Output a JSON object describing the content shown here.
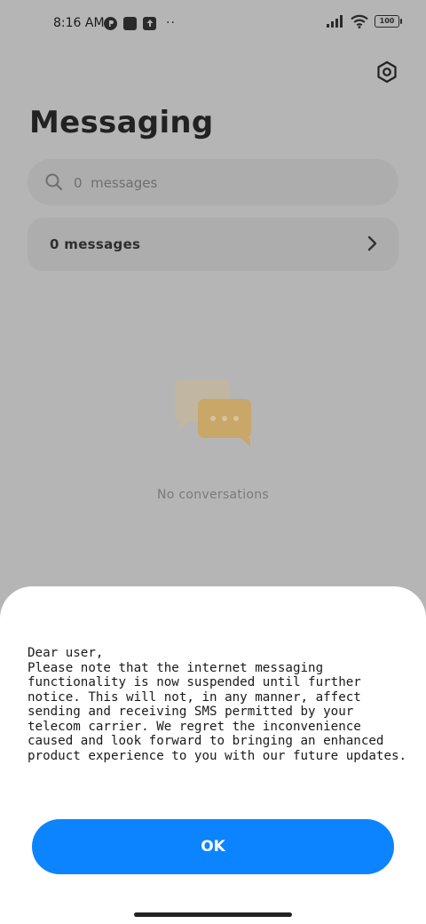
{
  "status_bar": {
    "time": "8:16 AM",
    "battery": "100",
    "more": "··"
  },
  "header": {
    "title": "Messaging",
    "settings_icon": "gear-icon"
  },
  "search": {
    "placeholder": "0  messages"
  },
  "messages_row": {
    "label": "0  messages"
  },
  "empty_state": {
    "text": "No  conversations"
  },
  "dialog": {
    "message": "Dear user,\nPlease note that the internet messaging functionality is now suspended until further notice. This will not, in any manner, affect sending and receiving SMS permitted by your telecom carrier. We regret the inconvenience caused and look forward to bringing an enhanced product experience to you with our future updates.",
    "ok_label": "OK"
  },
  "colors": {
    "accent": "#0c84ff",
    "scrim": "#b5b5b5"
  }
}
